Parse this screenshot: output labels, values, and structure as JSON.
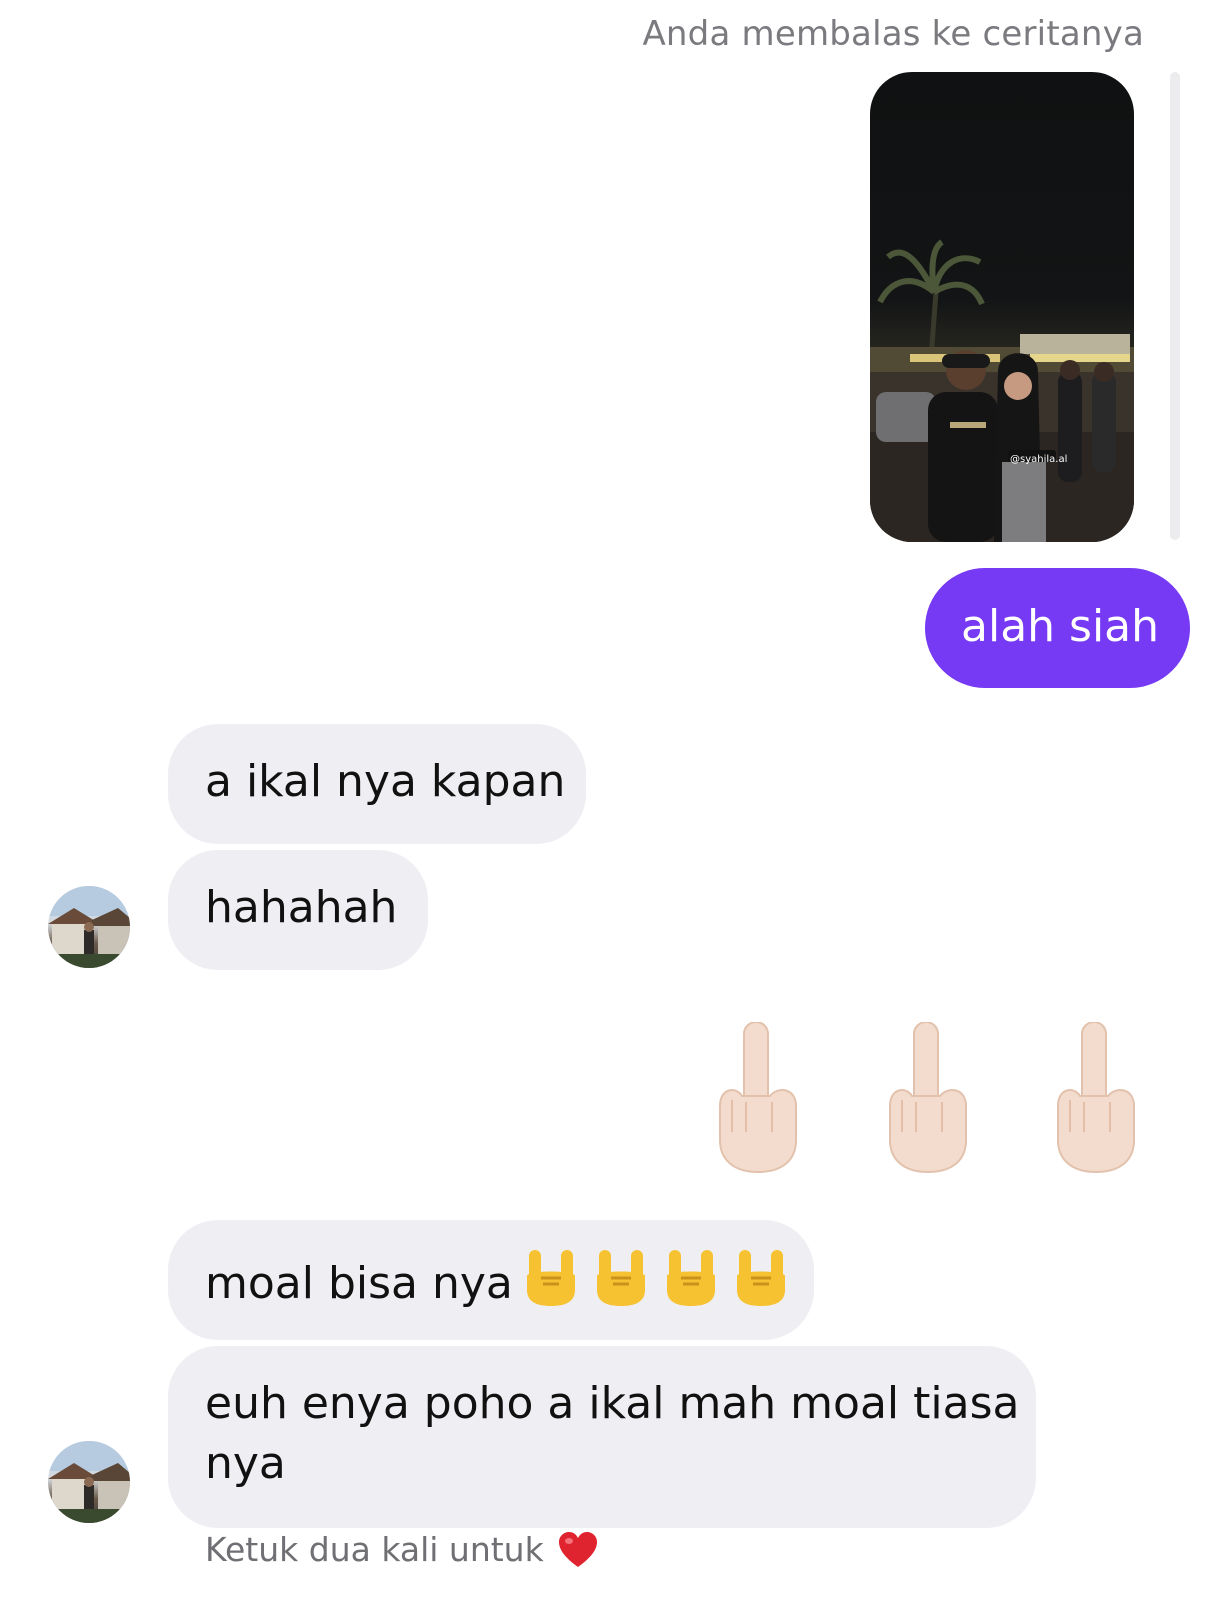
{
  "conversation": {
    "reply_note": "Anda membalas ke ceritanya",
    "story_tag": "@syahila.al",
    "messages": [
      {
        "side": "sent",
        "text": "alah siah"
      },
      {
        "side": "received",
        "text": "a ikal nya kapan"
      },
      {
        "side": "received",
        "text": "hahahah"
      },
      {
        "side": "sent",
        "emoji": "🖕🏻🖕🏻🖕🏻"
      },
      {
        "side": "received",
        "text": "moal bisa nya",
        "emoji": "🤘🤘🤘🤘"
      },
      {
        "side": "received",
        "text_line1": "euh enya poho a ikal mah moal tiasa",
        "text_line2": "nya"
      }
    ],
    "footer_hint": "Ketuk dua kali untuk",
    "footer_icon": "heart-icon"
  },
  "colors": {
    "sent_bubble": "#7639f4",
    "received_bubble": "#efeff3",
    "heart": "#e0242f"
  }
}
